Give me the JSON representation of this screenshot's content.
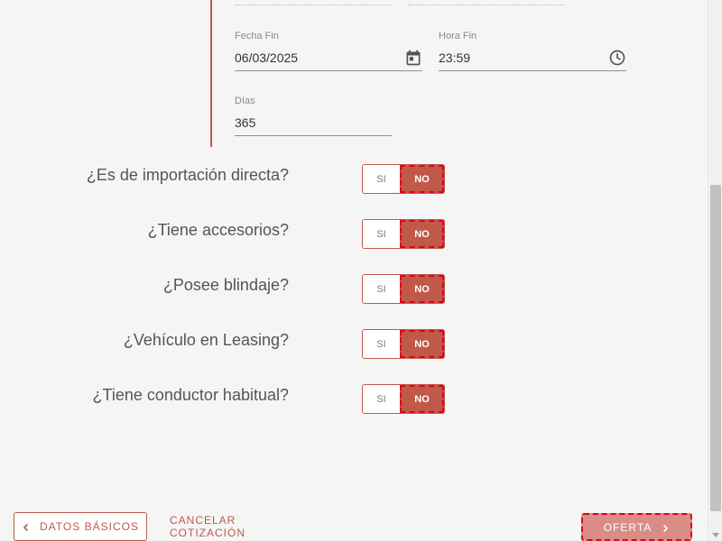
{
  "dates": {
    "fecha_fin": {
      "label": "Fecha Fin",
      "value": "06/03/2025"
    },
    "hora_fin": {
      "label": "Hora Fin",
      "value": "23:59"
    },
    "dias": {
      "label": "Días",
      "value": "365"
    }
  },
  "questions": [
    {
      "label": "¿Es de importación directa?",
      "si": "SI",
      "no": "NO",
      "selected": "NO"
    },
    {
      "label": "¿Tiene accesorios?",
      "si": "SI",
      "no": "NO",
      "selected": "NO"
    },
    {
      "label": "¿Posee blindaje?",
      "si": "SI",
      "no": "NO",
      "selected": "NO"
    },
    {
      "label": "¿Vehículo en Leasing?",
      "si": "SI",
      "no": "NO",
      "selected": "NO"
    },
    {
      "label": "¿Tiene conductor habitual?",
      "si": "SI",
      "no": "NO",
      "selected": "NO"
    }
  ],
  "footer": {
    "back_label": "DATOS BÁSICOS",
    "cancel_label": "CANCELAR COTIZACIÓN",
    "offer_label": "OFERTA"
  },
  "colors": {
    "accent": "#c0594a",
    "offer_button": "#d98d86",
    "highlight_outline": "#e0001a"
  },
  "icons": {
    "fecha_fin": "calendar-icon",
    "hora_fin": "clock-icon",
    "back": "chevron-left-icon",
    "offer": "chevron-right-icon"
  }
}
